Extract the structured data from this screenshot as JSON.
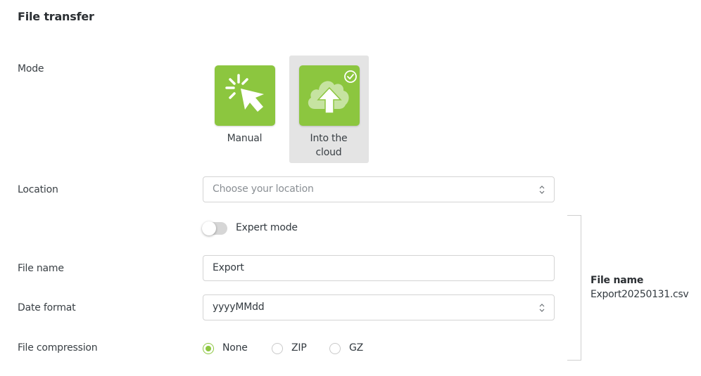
{
  "page": {
    "title": "File transfer"
  },
  "labels": {
    "mode": "Mode",
    "location": "Location",
    "file_name": "File name",
    "date_format": "Date format",
    "file_compression": "File compression"
  },
  "mode": {
    "options": [
      {
        "label": "Manual",
        "icon": "cursor-click-icon",
        "selected": false
      },
      {
        "label": "Into the cloud",
        "icon": "cloud-upload-icon",
        "selected": true
      }
    ],
    "accent_color": "#8cc63f"
  },
  "location": {
    "placeholder": "Choose your location",
    "value": ""
  },
  "expert_mode": {
    "label": "Expert mode",
    "enabled": false
  },
  "file_name": {
    "value": "Export"
  },
  "date_format": {
    "value": "yyyyMMdd"
  },
  "compression": {
    "options": [
      {
        "label": "None",
        "checked": true
      },
      {
        "label": "ZIP",
        "checked": false
      },
      {
        "label": "GZ",
        "checked": false
      }
    ]
  },
  "preview": {
    "title": "File name",
    "value": "Export20250131.csv"
  }
}
